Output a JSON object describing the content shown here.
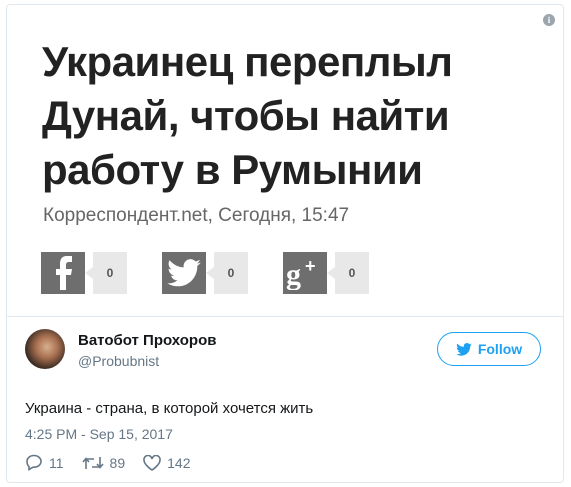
{
  "card": {
    "headline": "Украинец переплыл Дунай, чтобы найти работу в Румынии",
    "source": "Корреспондент.net, Сегодня, 15:47",
    "share": [
      {
        "network": "facebook",
        "icon": "facebook-icon",
        "count": "0"
      },
      {
        "network": "twitter",
        "icon": "twitter-bird-icon",
        "count": "0"
      },
      {
        "network": "google-plus",
        "icon": "google-plus-icon",
        "count": "0"
      }
    ]
  },
  "tweet": {
    "author_name": "Ватобот Прохоров",
    "author_handle": "@Probubnist",
    "follow_label": "Follow",
    "text": "Украина - страна, в которой хочется жить",
    "timestamp": "4:25 PM - Sep 15, 2017",
    "replies": "11",
    "retweets": "89",
    "likes": "142"
  },
  "colors": {
    "accent": "#1da1f2",
    "muted": "#657786",
    "share_bg": "#6e6e6e"
  }
}
